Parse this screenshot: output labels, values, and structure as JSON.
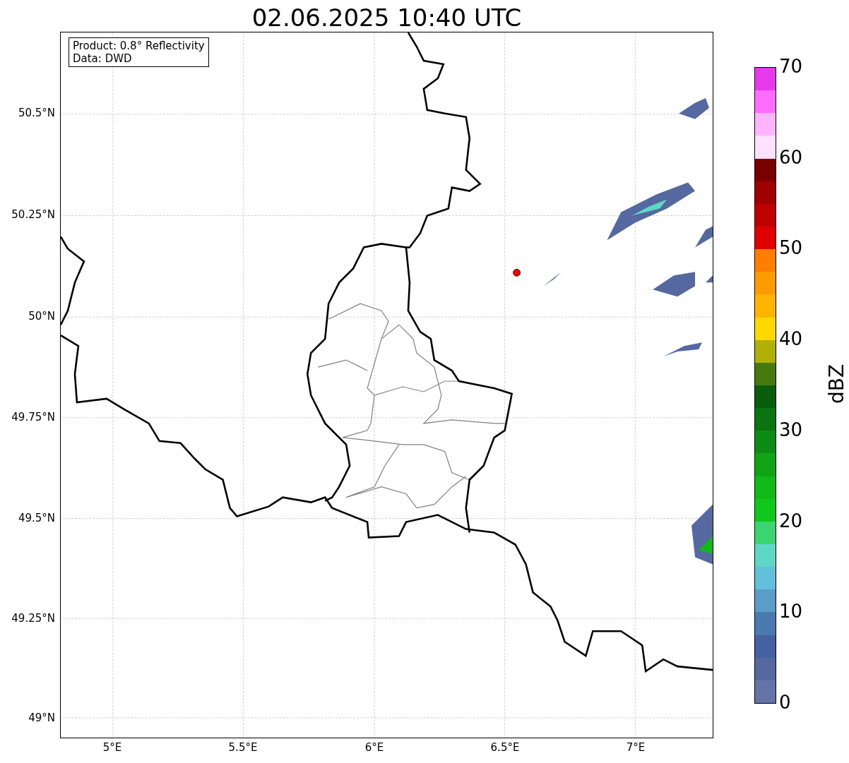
{
  "title": "02.06.2025 10:40 UTC",
  "map": {
    "legend": [
      "Product: 0.8° Reflectivity",
      "Data: DWD"
    ],
    "xticks": [
      "5°E",
      "5.5°E",
      "6°E",
      "6.5°E",
      "7°E"
    ],
    "yticks": [
      "50.5°N",
      "50.25°N",
      "50°N",
      "49.75°N",
      "49.5°N",
      "49.25°N",
      "49°N"
    ]
  },
  "colorbar": {
    "label": "dBZ",
    "ticks": [
      "70",
      "60",
      "50",
      "40",
      "30",
      "20",
      "10",
      "0"
    ],
    "bins": [
      {
        "color": "#e838ec"
      },
      {
        "color": "#ff6cff"
      },
      {
        "color": "#ffb4ff"
      },
      {
        "color": "#ffe0ff"
      },
      {
        "color": "#780000"
      },
      {
        "color": "#a00000"
      },
      {
        "color": "#c00000"
      },
      {
        "color": "#e00000"
      },
      {
        "color": "#ff7e00"
      },
      {
        "color": "#ff9a00"
      },
      {
        "color": "#ffb400"
      },
      {
        "color": "#ffd800"
      },
      {
        "color": "#b0b008"
      },
      {
        "color": "#467a0e"
      },
      {
        "color": "#085c0c"
      },
      {
        "color": "#0a7410"
      },
      {
        "color": "#0c8c14"
      },
      {
        "color": "#0ea414"
      },
      {
        "color": "#10b818"
      },
      {
        "color": "#10c81c"
      },
      {
        "color": "#3cd470"
      },
      {
        "color": "#5ed8c4"
      },
      {
        "color": "#62c0dc"
      },
      {
        "color": "#5a9ec8"
      },
      {
        "color": "#4a7ab0"
      },
      {
        "color": "#4360a0"
      },
      {
        "color": "#5568a0"
      },
      {
        "color": "#6574a6"
      }
    ]
  }
}
